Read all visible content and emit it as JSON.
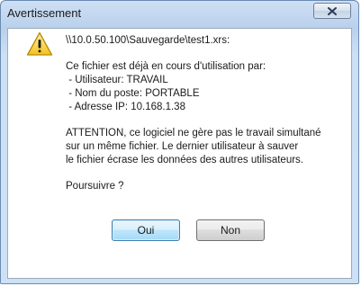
{
  "window": {
    "title": "Avertissement"
  },
  "message": {
    "path": "\\\\10.0.50.100\\Sauvegarde\\test1.xrs:",
    "intro": "Ce fichier est déjà en cours d'utilisation par:",
    "details": [
      " - Utilisateur: TRAVAIL",
      " - Nom du poste: PORTABLE",
      " - Adresse IP: 10.168.1.38"
    ],
    "warning": [
      "ATTENTION, ce logiciel ne gère pas le travail simultané",
      "sur un même fichier. Le dernier utilisateur à sauver",
      "le fichier écrase les données des autres utilisateurs."
    ],
    "question": "Poursuivre ?"
  },
  "buttons": {
    "yes_label": "Oui",
    "no_label": "Non"
  },
  "icons": {
    "warning": "warning-icon",
    "close": "close-icon"
  },
  "colors": {
    "title_bar": "#b9d0ec",
    "default_button": "#bee6fd",
    "warning_yellow": "#f7d23a"
  }
}
